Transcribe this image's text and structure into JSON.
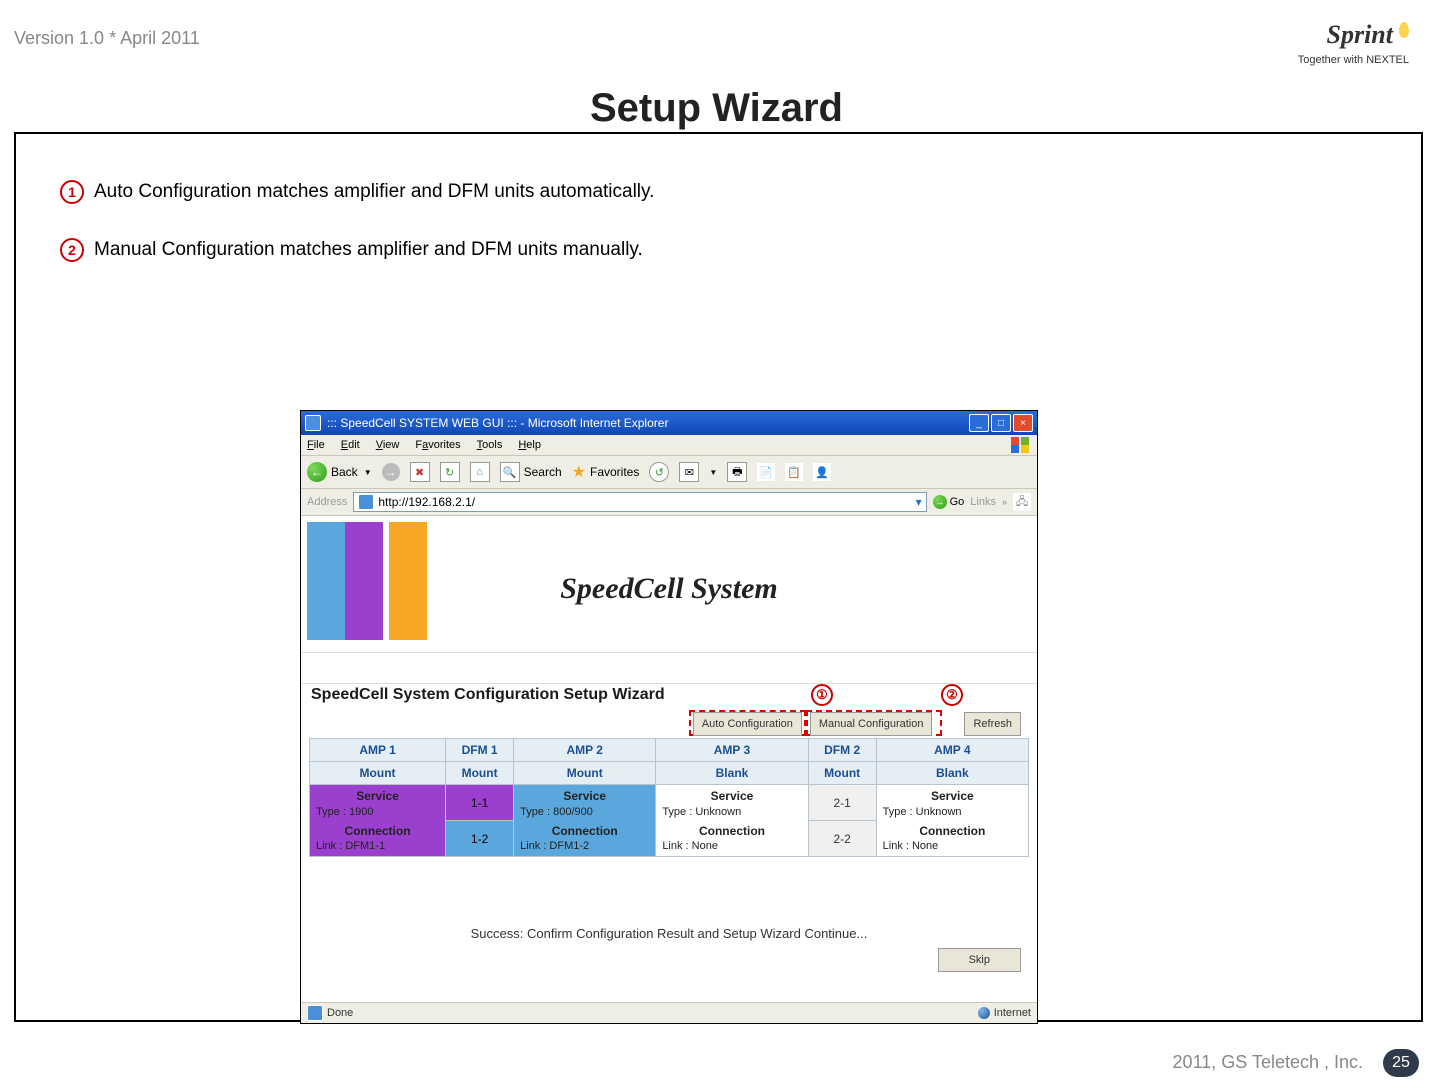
{
  "meta": {
    "version_line": "Version 1.0 * April 2011",
    "brand": "Sprint",
    "brand_tag": "Together with NEXTEL",
    "title": "Setup Wizard",
    "copyright": "2011, GS Teletech , Inc.",
    "page_number": "25"
  },
  "notes": {
    "n1": "Auto Configuration matches amplifier and DFM units automatically.",
    "n2": "Manual Configuration matches amplifier and DFM units manually."
  },
  "ie": {
    "title": "::: SpeedCell SYSTEM WEB GUI ::: - Microsoft Internet Explorer",
    "menu": {
      "file": "File",
      "edit": "Edit",
      "view": "View",
      "fav": "Favorites",
      "tools": "Tools",
      "help": "Help"
    },
    "tb": {
      "back": "Back",
      "search": "Search",
      "favorites": "Favorites"
    },
    "addr_label": "Address",
    "address": "http://192.168.2.1/",
    "go": "Go",
    "links": "Links",
    "content_title": "SpeedCell System",
    "wizard_header": "SpeedCell System Configuration Setup Wizard",
    "btn_auto": "Auto Configuration",
    "btn_manual": "Manual Configuration",
    "btn_refresh": "Refresh",
    "marker1": "①",
    "marker2": "②",
    "success": "Success: Confirm Configuration Result and Setup Wizard Continue...",
    "btn_skip": "Skip",
    "status_done": "Done",
    "status_zone": "Internet"
  },
  "grid": {
    "headers": {
      "amp1": "AMP 1",
      "dfm1": "DFM 1",
      "amp2": "AMP 2",
      "amp3": "AMP 3",
      "dfm2": "DFM 2",
      "amp4": "AMP 4"
    },
    "sub": {
      "amp1": "Mount",
      "dfm1": "Mount",
      "amp2": "Mount",
      "amp3": "Blank",
      "dfm2": "Mount",
      "amp4": "Blank"
    },
    "labels": {
      "service": "Service",
      "connection": "Connection"
    },
    "amp1": {
      "type": "Type : 1900",
      "link": "Link : DFM1-1"
    },
    "amp2": {
      "type": "Type : 800/900",
      "link": "Link : DFM1-2"
    },
    "amp3": {
      "type": "Type : Unknown",
      "link": "Link : None"
    },
    "amp4": {
      "type": "Type : Unknown",
      "link": "Link : None"
    },
    "dfm1": {
      "p1": "1-1",
      "p2": "1-2"
    },
    "dfm2": {
      "p1": "2-1",
      "p2": "2-2"
    }
  }
}
